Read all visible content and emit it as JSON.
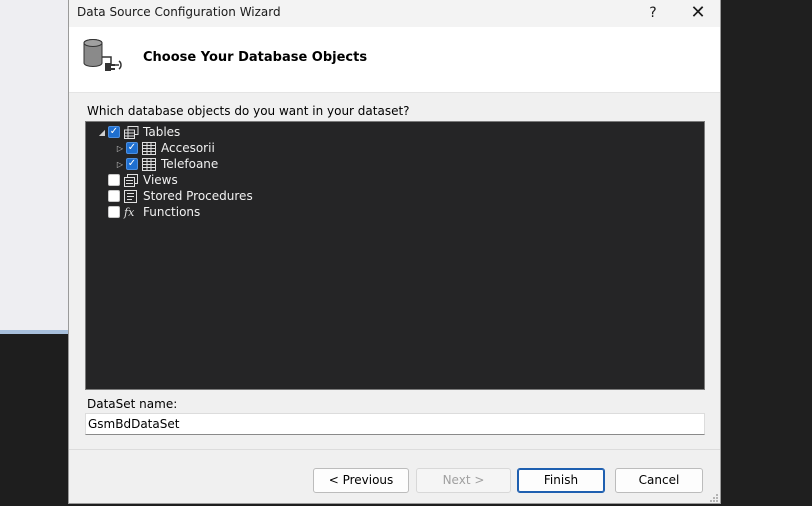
{
  "window": {
    "title": "Data Source Configuration Wizard",
    "help_label": "?",
    "close_label": "✕"
  },
  "header": {
    "title": "Choose Your Database Objects",
    "icon": "database-connection-icon"
  },
  "prompt": "Which database objects do you want in your dataset?",
  "tree": {
    "nodes": [
      {
        "label": "Tables",
        "checked": true,
        "expanded": true,
        "icon": "tables-icon"
      },
      {
        "label": "Accesorii",
        "checked": true,
        "expanded": false,
        "icon": "table-icon"
      },
      {
        "label": "Telefoane",
        "checked": true,
        "expanded": false,
        "icon": "table-icon"
      },
      {
        "label": "Views",
        "checked": false,
        "icon": "views-icon"
      },
      {
        "label": "Stored Procedures",
        "checked": false,
        "icon": "stored-procedures-icon"
      },
      {
        "label": "Functions",
        "checked": false,
        "icon": "function-icon"
      }
    ]
  },
  "dataset": {
    "label": "DataSet name:",
    "value": "GsmBdDataSet"
  },
  "buttons": {
    "previous": "< Previous",
    "next": "Next >",
    "finish": "Finish",
    "cancel": "Cancel"
  },
  "colors": {
    "accent": "#1e6fd0",
    "tree_background": "#252526"
  }
}
